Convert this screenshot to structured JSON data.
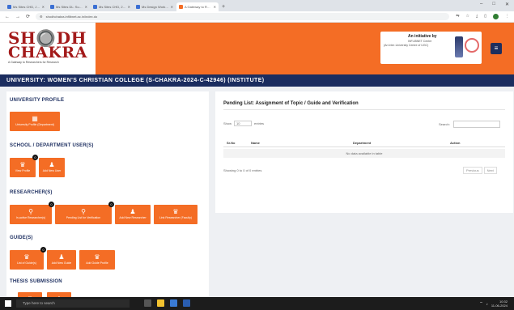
{
  "browser": {
    "tabs": [
      {
        "label": "Ms Sites CHD, Jan 2022 ..."
      },
      {
        "label": "Ms Sites DL: Summary ..."
      },
      {
        "label": "Ms Sites CHD, 2022 ..."
      },
      {
        "label": "Ms Design Working - ..."
      },
      {
        "label": "A Gateway to Researchers ..."
      }
    ],
    "url": "shodhchakra.inflibnet.ac.in/index.do",
    "window_controls": [
      "–",
      "□",
      "✕"
    ]
  },
  "header": {
    "logo_line1": "SH🔘DH",
    "logo_line2": "CHAKRA",
    "logo_tagline": "A Gateway to Researchers for Research",
    "initiative_title": "An initiative by",
    "initiative_sub": "INFLIBNET Centre",
    "initiative_sub2": "(An Inter-University Centre of UGC)",
    "accent": "#f46d25",
    "navy": "#1b2d5f"
  },
  "university_bar": "UNIVERSITY: WOMEN'S CHRISTIAN COLLEGE (S-CHAKRA-2024-C-42946) (INSTITUTE)",
  "sections": {
    "profile": {
      "title": "UNIVERSITY PROFILE",
      "buttons": [
        {
          "label": "University Profile (Department)"
        }
      ]
    },
    "school": {
      "title": "SCHOOL / DEPARTMENT USER(S)",
      "buttons": [
        {
          "label": "View Profile",
          "badge": "0"
        },
        {
          "label": "Add New User"
        }
      ]
    },
    "researcher": {
      "title": "RESEARCHER(S)",
      "buttons": [
        {
          "label": "In-active Researcher(s)",
          "badge": "0"
        },
        {
          "label": "Pending List for Verification",
          "badge": "0"
        },
        {
          "label": "Add New Researcher"
        },
        {
          "label": "Link Researcher (Faculty)"
        }
      ]
    },
    "guide": {
      "title": "GUIDE(S)",
      "buttons": [
        {
          "label": "List of Guide(s)",
          "badge": "0"
        },
        {
          "label": "Add New Guide"
        },
        {
          "label": "Add Guide Profile"
        }
      ]
    },
    "thesis": {
      "title": "THESIS SUBMISSION"
    }
  },
  "panel": {
    "title": "Pending List: Assignment of Topic / Guide and Verification",
    "show_label": "Show",
    "show_value": "10",
    "entries_label": "entries",
    "search_label": "Search:",
    "columns": [
      "Sr.No",
      "Name",
      "Department",
      "Action"
    ],
    "empty_text": "No data available in table",
    "info": "Showing 0 to 0 of 0 entries",
    "prev": "Previous",
    "next": "Next"
  },
  "taskbar": {
    "search_placeholder": "Type here to search",
    "time": "10:32",
    "date": "11-06-2024"
  }
}
